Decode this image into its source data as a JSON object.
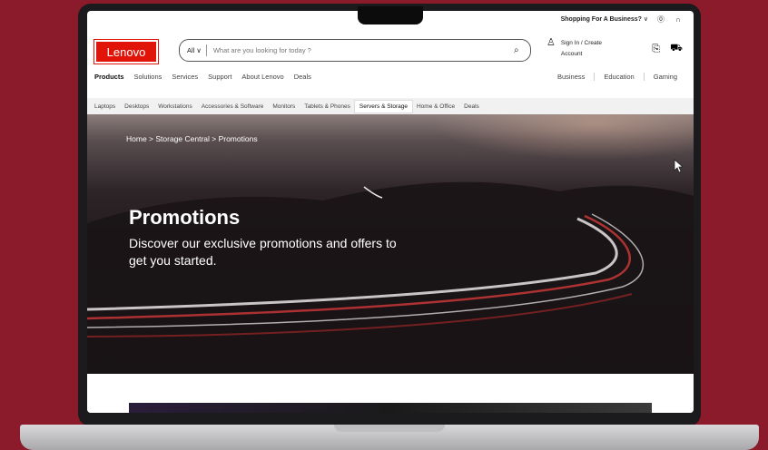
{
  "colors": {
    "background": "#8b1a2a",
    "brand": "#e1140a"
  },
  "utility": {
    "business": "Shopping For A Business?",
    "chevron": "∨",
    "help_icon": "help-circle-icon",
    "headset_icon": "headset-icon"
  },
  "header": {
    "logo": "Lenovo",
    "search": {
      "category": "All",
      "chevron": "∨",
      "placeholder": "What are you looking for today ?"
    },
    "account": {
      "line1": "Sign In / Create",
      "line2": "Account"
    }
  },
  "nav": {
    "items": [
      "Products",
      "Solutions",
      "Services",
      "Support",
      "About Lenovo",
      "Deals"
    ],
    "right": [
      "Business",
      "Education",
      "Gaming"
    ]
  },
  "categories": [
    "Laptops",
    "Desktops",
    "Workstations",
    "Accessories & Software",
    "Monitors",
    "Tablets & Phones",
    "Servers & Storage",
    "Home & Office",
    "Deals"
  ],
  "hero": {
    "breadcrumb": "Home > Storage Central > Promotions",
    "title": "Promotions",
    "subtitle": "Discover our exclusive promotions and offers to get you started."
  }
}
